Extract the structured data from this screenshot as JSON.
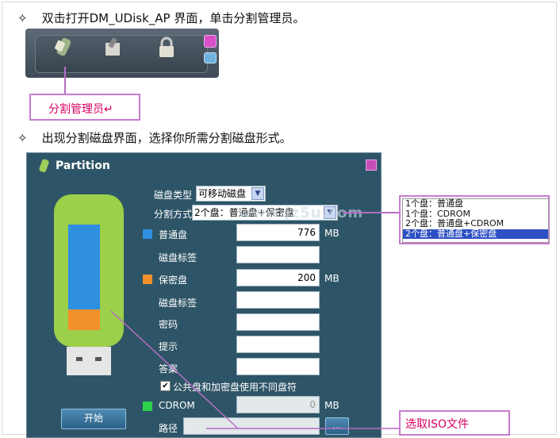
{
  "step1": {
    "bullet": "✧",
    "text": "双击打开DM_UDisk_AP 界面，单击分割管理员。"
  },
  "callout1": {
    "text": "分割管理员↵"
  },
  "step2": {
    "bullet": "✧",
    "text": "出现分割磁盘界面，选择你所需分割磁盘形式。"
  },
  "window": {
    "title": "Partition",
    "disk_type_label": "磁盘类型",
    "disk_type_value": "可移动磁盘",
    "partition_label": "分割方式",
    "partition_value": "2个盘：普通盘+保密盘",
    "normal_label": "普通盘",
    "normal_size": "776",
    "normal_unit": "MB",
    "normal_vol_label": "磁盘标签",
    "secret_label": "保密盘",
    "secret_size": "200",
    "secret_unit": "MB",
    "secret_vol_label": "磁盘标签",
    "password_label": "密码",
    "hint_label": "提示",
    "answer_label": "答案",
    "checkbox_label": "公共盘和加密盘使用不同盘符",
    "checkbox_mark": "✔",
    "cdrom_label": "CDROM",
    "cdrom_size": "0",
    "cdrom_unit": "MB",
    "path_label": "路径",
    "browse_label": "...",
    "start_label": "开始",
    "colors": {
      "normal": "#2e8fe0",
      "secret": "#f2902c",
      "cdrom": "#2bd14a"
    }
  },
  "dropdown": {
    "options": [
      "1个盘：普通盘",
      "1个盘：CDROM",
      "2个盘：普通盘+CDROM",
      "2个盘：普通盘+保密盘"
    ],
    "selected": 3
  },
  "callout2": {
    "text": "选取ISO文件"
  },
  "watermark": "www.jz5u.com"
}
